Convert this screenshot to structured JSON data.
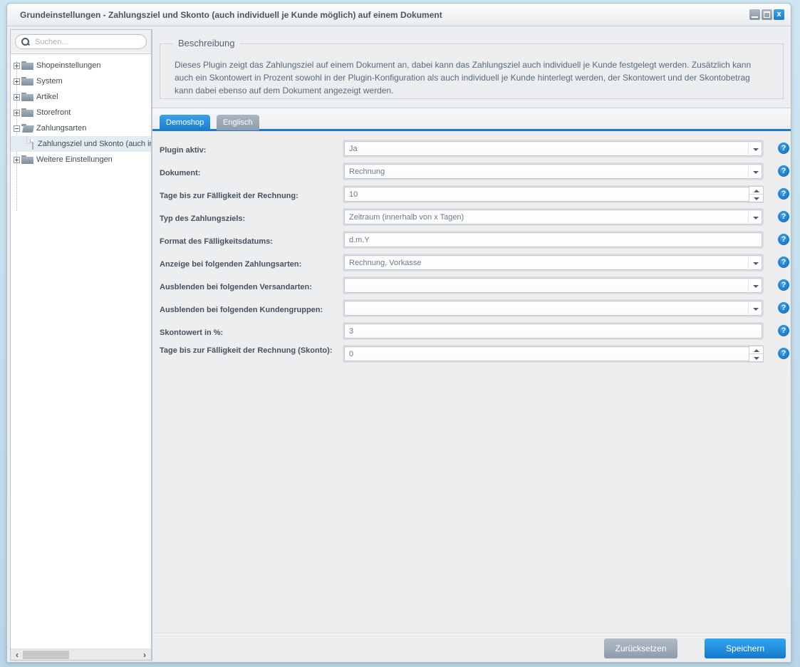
{
  "window": {
    "title": "Grundeinstellungen - Zahlungsziel und Skonto (auch individuell je Kunde möglich) auf einem Dokument",
    "controls": {
      "minimize": "minimize",
      "maximize": "maximize",
      "close": "x"
    }
  },
  "sidebar": {
    "search_placeholder": "Suchen...",
    "tree": [
      {
        "label": "Shopeinstellungen",
        "expanded": false
      },
      {
        "label": "System",
        "expanded": false
      },
      {
        "label": "Artikel",
        "expanded": false
      },
      {
        "label": "Storefront",
        "expanded": false
      },
      {
        "label": "Zahlungsarten",
        "expanded": true
      },
      {
        "label": "Zahlungsziel und Skonto (auch individuell je Kunde möglich) auf einem Dokument",
        "selected": true
      },
      {
        "label": "Weitere Einstellungen",
        "expanded": false
      }
    ],
    "scroll_left": "‹",
    "scroll_right": "›"
  },
  "description": {
    "legend": "Beschreibung",
    "text": "Dieses Plugin zeigt das Zahlungsziel auf einem Dokument an, dabei kann das Zahlungsziel auch individuell je Kunde festgelegt werden. Zusätzlich kann auch ein Skontowert in Prozent sowohl in der Plugin-Konfiguration als auch individuell je Kunde hinterlegt werden, der Skontowert und der Skontobetrag kann dabei ebenso auf dem Dokument angezeigt werden."
  },
  "tabs": [
    {
      "label": "Demoshop",
      "active": true
    },
    {
      "label": "Englisch",
      "active": false
    }
  ],
  "form": {
    "fields": [
      {
        "label": "Plugin aktiv:",
        "value": "Ja",
        "type": "combo"
      },
      {
        "label": "Dokument:",
        "value": "Rechnung",
        "type": "combo"
      },
      {
        "label": "Tage bis zur Fälligkeit der Rechnung:",
        "value": "10",
        "type": "number"
      },
      {
        "label": "Typ des Zahlungsziels:",
        "value": "Zeitraum (innerhalb von x Tagen)",
        "type": "combo"
      },
      {
        "label": "Format des Fälligkeitsdatums:",
        "value": "d.m.Y",
        "type": "text"
      },
      {
        "label": "Anzeige bei folgenden Zahlungsarten:",
        "value": "Rechnung, Vorkasse",
        "type": "combo"
      },
      {
        "label": "Ausblenden bei folgenden Versandarten:",
        "value": "",
        "type": "combo"
      },
      {
        "label": "Ausblenden bei folgenden Kundengruppen:",
        "value": "",
        "type": "combo"
      },
      {
        "label": "Skontowert in %:",
        "value": "3",
        "type": "text"
      },
      {
        "label": "Tage bis zur Fälligkeit der Rechnung (Skonto):",
        "value": "0",
        "type": "number"
      }
    ],
    "help_glyph": "?"
  },
  "footer": {
    "reset_label": "Zurücksetzen",
    "save_label": "Speichern"
  },
  "colors": {
    "accent": "#1f79c8",
    "save_button": "#1d86d8",
    "reset_button": "#9eabb8"
  }
}
